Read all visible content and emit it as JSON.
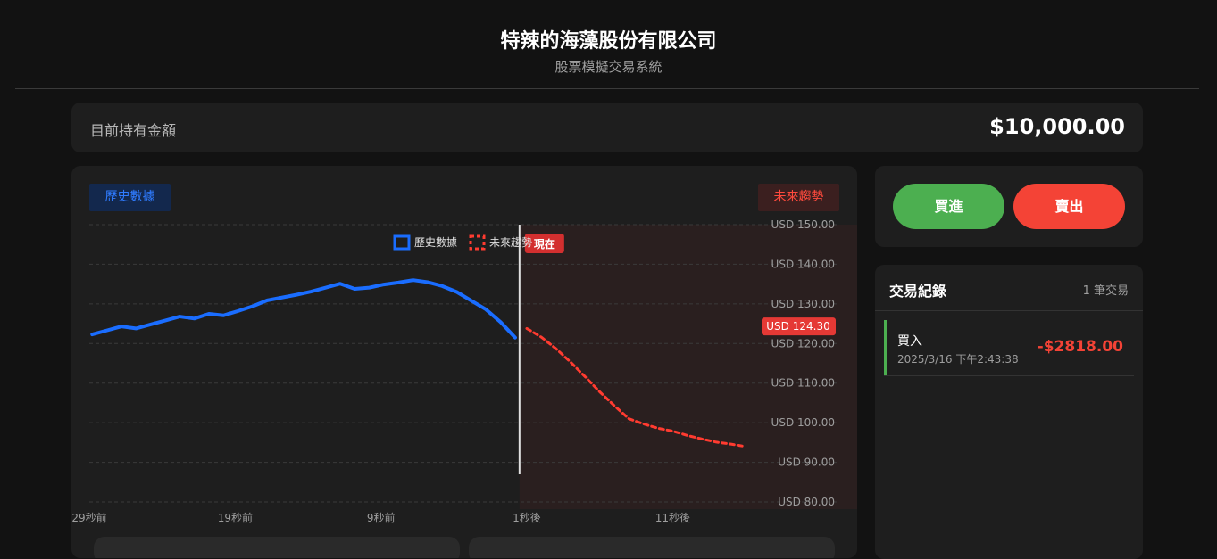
{
  "header": {
    "title": "特辣的海藻股份有限公司",
    "subtitle": "股票模擬交易系統"
  },
  "balance": {
    "label": "目前持有金額",
    "value": "$10,000.00"
  },
  "chart_tags": {
    "history": "歷史數據",
    "future": "未來趨勢"
  },
  "chart_data": {
    "type": "line",
    "colors": {
      "history": "#1a6dff",
      "future": "#ff3b30",
      "current_badge": "#e53935",
      "now_badge": "#d32f2f"
    },
    "legend": [
      "歷史數據",
      "未來趨勢"
    ],
    "now_label": "現在",
    "current_price_label": "USD 124.30",
    "current_price": 124.3,
    "ylim": [
      80,
      150
    ],
    "y_ticks": [
      "USD 150.00",
      "USD 140.00",
      "USD 130.00",
      "USD 120.00",
      "USD 110.00",
      "USD 100.00",
      "USD 90.00",
      "USD 80.00"
    ],
    "y_tick_values": [
      150,
      140,
      130,
      120,
      110,
      100,
      90,
      80
    ],
    "x_ticks": [
      "29秒前",
      "19秒前",
      "9秒前",
      "1秒後",
      "11秒後"
    ],
    "x_tick_values": [
      -29,
      -19,
      -9,
      1,
      11
    ],
    "xlim": [
      -29,
      16
    ],
    "now_x": 0.5,
    "series": [
      {
        "name": "歷史數據",
        "style": "solid",
        "x": [
          -28.8,
          -27.8,
          -26.8,
          -25.8,
          -24.8,
          -23.8,
          -22.8,
          -21.8,
          -20.8,
          -19.8,
          -18.8,
          -17.8,
          -16.8,
          -15.8,
          -14.8,
          -13.8,
          -12.8,
          -11.8,
          -10.8,
          -9.8,
          -8.8,
          -7.8,
          -6.8,
          -5.8,
          -4.8,
          -3.8,
          -2.8,
          -1.8,
          -0.8,
          0.2
        ],
        "values": [
          122.3,
          123.3,
          124.3,
          123.8,
          124.8,
          125.8,
          126.8,
          126.3,
          127.5,
          127.1,
          128.2,
          129.4,
          130.9,
          131.6,
          132.3,
          133.1,
          134.1,
          135.1,
          133.8,
          134.1,
          134.9,
          135.4,
          136.0,
          135.5,
          134.5,
          133.0,
          130.8,
          128.6,
          125.4,
          121.5
        ]
      },
      {
        "name": "未來趨勢",
        "style": "dashed",
        "x": [
          1,
          2,
          3,
          4,
          5,
          6,
          7,
          8,
          9,
          10,
          11,
          12,
          13,
          14,
          15,
          16
        ],
        "values": [
          123.8,
          121.6,
          118.7,
          115.3,
          111.6,
          107.8,
          104.3,
          101.0,
          99.7,
          98.6,
          97.9,
          96.8,
          95.9,
          95.1,
          94.6,
          94.0
        ]
      }
    ]
  },
  "trade": {
    "buy": "買進",
    "sell": "賣出"
  },
  "history": {
    "title": "交易紀錄",
    "count": "1 筆交易",
    "items": [
      {
        "type": "買入",
        "time": "2025/3/16 下午2:43:38",
        "amount": "-$2818.00"
      }
    ]
  }
}
